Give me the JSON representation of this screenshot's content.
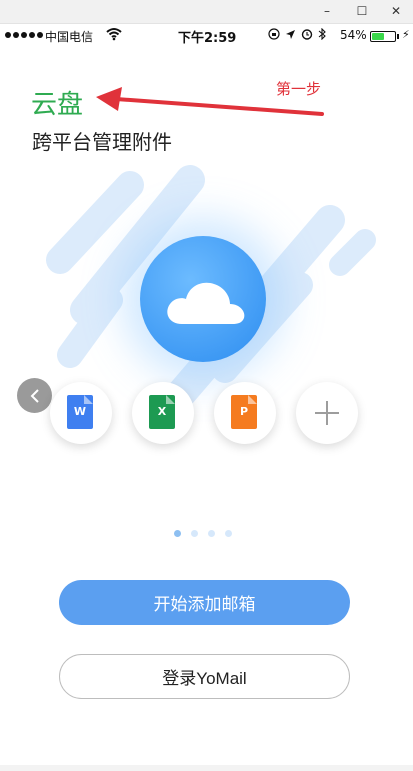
{
  "window": {
    "minimize_glyph": "–",
    "maximize_glyph": "☐",
    "close_glyph": "✕"
  },
  "status_bar": {
    "carrier": "中国电信",
    "time": "下午2:59",
    "battery_percent": "54%",
    "battery_level": 0.54,
    "icons": [
      "signal-dots-icon",
      "wifi-icon",
      "orientation-lock-icon",
      "location-icon",
      "alarm-icon",
      "bluetooth-icon",
      "battery-icon",
      "charging-bolt-icon"
    ]
  },
  "intro": {
    "title": "云盘",
    "subtitle": "跨平台管理附件",
    "annotation": "第一步"
  },
  "colors": {
    "title_green": "#2fab51",
    "annotation_red": "#e0323a",
    "primary_blue": "#5b9ff0",
    "word_blue": "#3f7ff0",
    "excel_green": "#1d9a52",
    "ppt_orange": "#f57b1f"
  },
  "file_types": [
    {
      "letter": "W",
      "icon": "word-document-icon",
      "color": "#3f7ff0"
    },
    {
      "letter": "X",
      "icon": "excel-document-icon",
      "color": "#1d9a52"
    },
    {
      "letter": "P",
      "icon": "powerpoint-document-icon",
      "color": "#f57b1f"
    }
  ],
  "add_icon": "plus-icon",
  "back_icon": "chevron-left-icon",
  "pagination": {
    "total": 4,
    "current": 1
  },
  "actions": {
    "start_label": "开始添加邮箱",
    "login_label": "登录YoMail"
  }
}
